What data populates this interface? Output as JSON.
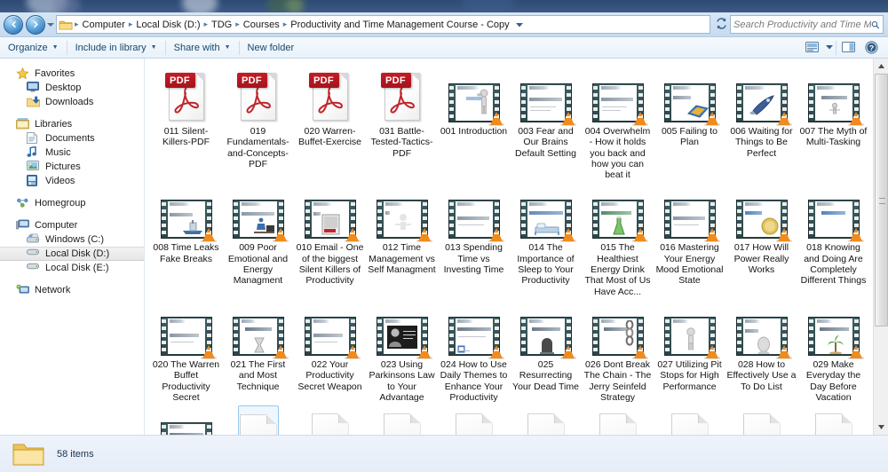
{
  "window": {
    "title": "Productivity and Time Management Course - Copy"
  },
  "addressbar": {
    "back_icon": "back-arrow-icon",
    "forward_icon": "forward-arrow-icon",
    "recent_pages_icon": "chevron-down-icon",
    "folder_icon": "folder-icon",
    "crumbs": [
      "Computer",
      "Local Disk (D:)",
      "TDG",
      "Courses",
      "Productivity and Time Management Course - Copy"
    ],
    "separator": "▸",
    "dropdown_icon": "chevron-down-icon",
    "refresh_icon": "refresh-icon"
  },
  "search": {
    "placeholder": "Search Productivity and Time Manage...",
    "value": "",
    "icon": "search-icon"
  },
  "toolbar": {
    "items": [
      {
        "label": "Organize",
        "has_caret": true
      },
      {
        "label": "Include in library",
        "has_caret": true
      },
      {
        "label": "Share with",
        "has_caret": true
      },
      {
        "label": "New folder",
        "has_caret": false
      }
    ],
    "right_icons": [
      "change-view-icon",
      "chevron-down-icon",
      "preview-pane-icon",
      "help-icon"
    ],
    "caret_glyph": "▼"
  },
  "sidebar": {
    "groups": [
      {
        "header": {
          "label": "Favorites",
          "icon": "star-icon"
        },
        "items": [
          {
            "label": "Desktop",
            "icon": "desktop-icon"
          },
          {
            "label": "Downloads",
            "icon": "downloads-icon"
          }
        ]
      },
      {
        "header": {
          "label": "Libraries",
          "icon": "libraries-icon"
        },
        "items": [
          {
            "label": "Documents",
            "icon": "documents-icon"
          },
          {
            "label": "Music",
            "icon": "music-icon"
          },
          {
            "label": "Pictures",
            "icon": "pictures-icon"
          },
          {
            "label": "Videos",
            "icon": "videos-icon"
          }
        ]
      },
      {
        "header": {
          "label": "Homegroup",
          "icon": "homegroup-icon"
        },
        "items": []
      },
      {
        "header": {
          "label": "Computer",
          "icon": "computer-icon"
        },
        "items": [
          {
            "label": "Windows (C:)",
            "icon": "hard-drive-icon",
            "selected": false
          },
          {
            "label": "Local Disk (D:)",
            "icon": "drive-icon",
            "selected": true
          },
          {
            "label": "Local Disk (E:)",
            "icon": "drive-icon",
            "selected": false
          }
        ]
      },
      {
        "header": {
          "label": "Network",
          "icon": "network-icon"
        },
        "items": []
      }
    ]
  },
  "files": {
    "rows": [
      [
        {
          "name": "011 Silent-Killers-PDF",
          "type": "pdf",
          "badge": "PDF"
        },
        {
          "name": "019 Fundamentals-and-Concepts-PDF",
          "type": "pdf",
          "badge": "PDF"
        },
        {
          "name": "020 Warren-Buffet-Exercise",
          "type": "pdf",
          "badge": "PDF"
        },
        {
          "name": "031 Battle-Tested-Tactics-PDF",
          "type": "pdf",
          "badge": "PDF"
        },
        {
          "name": "001 Introduction",
          "type": "video",
          "slide_title": "001 Introduction",
          "slide_sub": "WELCOME!",
          "art": "stick-figure"
        },
        {
          "name": "003 Fear and Our Brains Default Setting",
          "type": "video",
          "slide_title": "The Silent Killers of Productivity",
          "slide_sub": "Fear and Our Brains Default Setting",
          "art": "none"
        },
        {
          "name": "004 Overwhelm - How it holds you back and how you can beat it",
          "type": "video",
          "slide_title": "The Silent Killers of Productivity",
          "slide_sub": "Overwhelm",
          "art": "none"
        },
        {
          "name": "005 Failing to Plan",
          "type": "video",
          "slide_title": "Silent Killers of Productivity",
          "slide_sub": "Failing to Plan",
          "art": "map"
        },
        {
          "name": "006 Waiting for Things to Be Perfect",
          "type": "video",
          "slide_title": "Silent Killers of Productivity",
          "slide_sub": "Waiting for Perfect",
          "art": "rocket"
        },
        {
          "name": "007 The Myth of Multi-Tasking",
          "type": "video",
          "slide_title": "Silent Killers of Productivity",
          "slide_sub": "The Myth of Multi-tasking",
          "art": "stick-figure"
        }
      ],
      [
        {
          "name": "008 Time Leaks Fake Breaks",
          "type": "video",
          "slide_title": "Silent Killers of Productivity",
          "slide_sub": "Time Breaks & Time Leaks",
          "art": "boat"
        },
        {
          "name": "009 Poor Emotional and Energy Managment",
          "type": "video",
          "slide_title": "Silent Killers of Productivity",
          "slide_sub": "Poor Emotional and Energy Management",
          "art": "desk"
        },
        {
          "name": "010 Email - One of the biggest Silent Killers of Productivity",
          "type": "video",
          "slide_title": "Silent Killers of Productivity",
          "slide_sub": "Email",
          "art": "book"
        },
        {
          "name": "012 Time Management vs Self Managment",
          "type": "video",
          "slide_title": "Keys to Productivity Mastery",
          "slide_sub": "",
          "art": "faint-figure"
        },
        {
          "name": "013 Spending Time vs Investing Time",
          "type": "video",
          "slide_title": "Keys to Productivity Mastery",
          "slide_sub": "Ten Keys to Productivity Mastery",
          "art": "none"
        },
        {
          "name": "014 The Importance of Sleep to Your Productivity",
          "type": "video",
          "slide_title": "Keys to Productivity Mastery",
          "slide_sub": "The Importance of Sleep & Rest",
          "art": "bed"
        },
        {
          "name": "015 The Healthiest Energy Drink That Most of Us Have Acc...",
          "type": "video",
          "slide_title": "Keys to Productivity Mastery",
          "slide_sub": "The Healthiest Energy Drink",
          "art": "flask"
        },
        {
          "name": "016 Mastering Your Energy Mood  Emotional State",
          "type": "video",
          "slide_title": "Keys to Productivity Mastery",
          "slide_sub": "Ten Keys to Productivity Mastery",
          "art": "none"
        },
        {
          "name": "017 How Will Power Really Works",
          "type": "video",
          "slide_title": "Keys to Productivity Mastery",
          "slide_sub": "WORLD IMPLICATIONS",
          "art": "coin"
        },
        {
          "name": "018 Knowing and Doing Are Completely Different Things",
          "type": "video",
          "slide_title": "Keys to Productivity Mastery",
          "slide_sub": "I ALREADY KNOW THIS",
          "art": "none"
        }
      ],
      [
        {
          "name": "020 The Warren Buffet Productivity Secret",
          "type": "video",
          "slide_title": "Productivity Tactics",
          "slide_sub": "Top Productivity Tactics",
          "art": "none"
        },
        {
          "name": "021 The First and Most Technique",
          "type": "video",
          "slide_title": "Productivity Tactics",
          "slide_sub": "First and Most Technique",
          "art": "hourglass"
        },
        {
          "name": "022 Your Productivity Secret Weapon",
          "type": "video",
          "slide_title": "Productivity Tactics",
          "slide_sub": "Top Productivity Tactics",
          "art": "none"
        },
        {
          "name": "023 Using Parkinsons Law to Your Advantage",
          "type": "video",
          "slide_title": "Productivity Tactics",
          "slide_sub": "Parkinsons Law",
          "art": "portrait"
        },
        {
          "name": "024 How to Use Daily Themes to Enhance Your Productivity",
          "type": "video",
          "slide_title": "Productivity Tactics",
          "slide_sub": "Daily Themes to Enhance Productivity",
          "art": "calendar"
        },
        {
          "name": "025 Resurrecting Your Dead Time",
          "type": "video",
          "slide_title": "Productivity Tactics",
          "slide_sub": "Resurrect Your Dead Time",
          "art": "tombstone"
        },
        {
          "name": "026 Dont Break The Chain - The Jerry Seinfeld Strategy",
          "type": "video",
          "slide_title": "Productivity Tactics",
          "slide_sub": "Don't Break The Chain",
          "art": "chain"
        },
        {
          "name": "027 Utilizing Pit Stops for High Performance",
          "type": "video",
          "slide_title": "Productivity Tactics",
          "slide_sub": "",
          "art": "stick-figure"
        },
        {
          "name": "028 How to Effectively Use a To Do List",
          "type": "video",
          "slide_title": "Productivity Tactics",
          "slide_sub": "To Do List",
          "art": "head"
        },
        {
          "name": "029 Make Everyday the Day Before Vacation",
          "type": "video",
          "slide_title": "Productivity Tactics",
          "slide_sub": "Make Everyday the Day Before Vacation",
          "art": "palm"
        }
      ],
      [
        {
          "name": "",
          "type": "video",
          "slide_title": "Productivity Tactics",
          "slide_sub": "Habits and Routines to Automate Productivity",
          "art": "gear"
        },
        {
          "name": "",
          "type": "blank",
          "selected": true
        },
        {
          "name": "",
          "type": "blank"
        },
        {
          "name": "",
          "type": "blank"
        },
        {
          "name": "",
          "type": "blank"
        },
        {
          "name": "",
          "type": "blank"
        },
        {
          "name": "",
          "type": "blank"
        },
        {
          "name": "",
          "type": "blank"
        },
        {
          "name": "",
          "type": "blank"
        },
        {
          "name": "",
          "type": "blank"
        }
      ]
    ]
  },
  "scrollbar": {
    "up_glyph": "▲",
    "down_glyph": "▼"
  },
  "statusbar": {
    "icon": "folder-icon",
    "item_count_label": "58 items"
  },
  "colors": {
    "accent": "#2a5f92",
    "pdf_red": "#c41d26",
    "vlc_orange": "#f08b1d",
    "selection_blue": "#99c9ef"
  }
}
